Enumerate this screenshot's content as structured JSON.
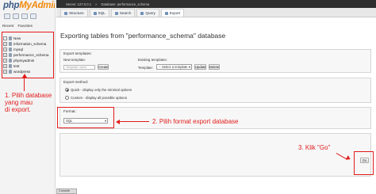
{
  "app": {
    "logo_main": "php",
    "logo_accent": "MyAdmin",
    "nav_tabs": [
      "Recent",
      "Favorites"
    ]
  },
  "databases": [
    "New",
    "information_schema",
    "mysql",
    "performance_schema",
    "phpmyadmin",
    "test",
    "wordpress"
  ],
  "topbar": {
    "items": [
      "Server: 127.0.0.1",
      "Database: performance_schema"
    ]
  },
  "tabs": [
    "Structure",
    "SQL",
    "Search",
    "Query",
    "Export"
  ],
  "active_tab": "Export",
  "page": {
    "title": "Exporting tables from \"performance_schema\" database"
  },
  "export_templates": {
    "legend": "Export templates:",
    "new_template_label": "New template:",
    "template_name_placeholder": "Template name",
    "create_label": "Create",
    "existing_templates_label": "Existing templates:",
    "template_label": "Template:",
    "select_template": "-- Select a template --",
    "update_label": "Update",
    "delete_label": "Delete"
  },
  "export_method": {
    "legend": "Export method:",
    "options": [
      "Quick - display only the minimal options",
      "Custom - display all possible options"
    ],
    "selected": 0
  },
  "format": {
    "legend": "Format:",
    "value": "SQL"
  },
  "go_label": "Go",
  "annotations": {
    "step1": [
      "1. Pilih database",
      "yang mau",
      "di export."
    ],
    "step2": "2. Pilih format export database",
    "step3": "3. Klik \"Go\""
  },
  "console_label": "Console",
  "colors": {
    "annotation_red": "#e21b1b",
    "logo_blue": "#3b5c87",
    "logo_orange": "#f28a0c"
  }
}
